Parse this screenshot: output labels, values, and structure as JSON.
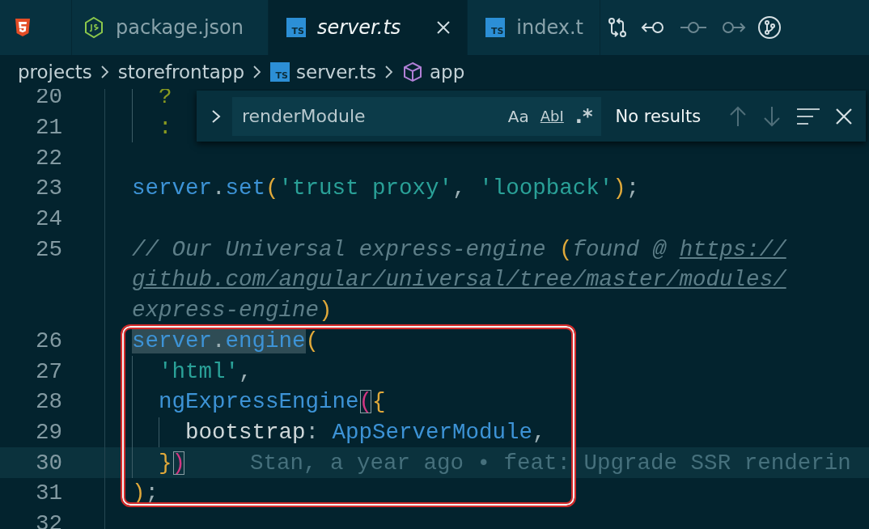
{
  "tabs": [
    {
      "kind": "html",
      "selected": false
    },
    {
      "kind": "node",
      "label": "package.json",
      "selected": false
    },
    {
      "kind": "ts",
      "badge": "TS",
      "label": "server.ts",
      "selected": true
    },
    {
      "kind": "ts",
      "badge": "TS",
      "label": "index.t",
      "selected": false
    }
  ],
  "breadcrumb": [
    {
      "kind": "folder",
      "label": "projects"
    },
    {
      "kind": "folder",
      "label": "storefrontapp"
    },
    {
      "kind": "ts",
      "badge": "TS",
      "label": "server.ts"
    },
    {
      "kind": "module",
      "label": "app"
    }
  ],
  "find": {
    "value": "renderModule",
    "options": [
      "Aa",
      "AbI",
      ".*"
    ],
    "status": "No results"
  },
  "lines": [
    {
      "number": "20",
      "current": false,
      "visual_lines": [
        {
          "tokens": [
            {
              "kind": "op",
              "t": "  ?"
            }
          ]
        }
      ]
    },
    {
      "number": "21",
      "current": false,
      "visual_lines": [
        {
          "tokens": [
            {
              "kind": "op",
              "t": "  :"
            }
          ]
        }
      ]
    },
    {
      "number": "22",
      "current": false
    },
    {
      "number": "23",
      "current": false,
      "visual_lines": [
        {
          "tokens": [
            {
              "kind": "var",
              "t": "server"
            },
            {
              "kind": "punct",
              "t": "."
            },
            {
              "kind": "var",
              "t": "set"
            },
            {
              "kind": "bracket",
              "t": "("
            },
            {
              "kind": "string",
              "t": "'trust proxy'"
            },
            {
              "kind": "punct",
              "t": ", "
            },
            {
              "kind": "string",
              "t": "'loopback'"
            },
            {
              "kind": "bracket",
              "t": ")"
            },
            {
              "kind": "punct",
              "t": ";"
            }
          ]
        }
      ]
    },
    {
      "number": "24",
      "current": false
    },
    {
      "number": "25",
      "current": false,
      "visual_lines": [
        {
          "tokens": [
            {
              "kind": "comment",
              "t": "// Our Universal express-engine "
            },
            {
              "kind": "bracket",
              "t": "("
            },
            {
              "kind": "comment",
              "t": "found @ "
            },
            {
              "kind": "link",
              "t": "https://"
            }
          ]
        },
        {
          "tokens": [
            {
              "kind": "link",
              "t": "github.com/angular/universal/tree/master/modules/"
            }
          ]
        },
        {
          "tokens": [
            {
              "kind": "comment",
              "t": "express-engine"
            },
            {
              "kind": "bracket",
              "t": ")"
            }
          ]
        }
      ]
    },
    {
      "number": "26",
      "current": false,
      "visual_lines": [
        {
          "tokens": [
            {
              "kind": "var-hl",
              "t": "server"
            },
            {
              "kind": "punct-hl",
              "t": "."
            },
            {
              "kind": "var-hl",
              "t": "engine"
            },
            {
              "kind": "bracket",
              "t": "("
            }
          ]
        }
      ]
    },
    {
      "number": "27",
      "current": false,
      "visual_lines": [
        {
          "tokens": [
            {
              "kind": "string",
              "t": "  'html'"
            },
            {
              "kind": "punct",
              "t": ","
            }
          ]
        }
      ]
    },
    {
      "number": "28",
      "current": false,
      "visual_lines": [
        {
          "tokens": [
            {
              "kind": "var",
              "t": "  ngExpressEngine"
            },
            {
              "kind": "bracket-match",
              "t": "("
            },
            {
              "kind": "bracket",
              "t": "{"
            }
          ]
        }
      ]
    },
    {
      "number": "29",
      "current": false,
      "visual_lines": [
        {
          "tokens": [
            {
              "kind": "prop",
              "t": "    bootstrap"
            },
            {
              "kind": "punct",
              "t": ": "
            },
            {
              "kind": "var",
              "t": "AppServerModule"
            },
            {
              "kind": "punct",
              "t": ","
            }
          ]
        }
      ]
    },
    {
      "number": "30",
      "current": true,
      "blame": "Stan, a year ago • feat: Upgrade SSR renderin",
      "visual_lines": [
        {
          "tokens": [
            {
              "kind": "bracket",
              "t": "  }"
            },
            {
              "kind": "bracket-match",
              "t": ")"
            }
          ]
        }
      ]
    },
    {
      "number": "31",
      "current": false,
      "visual_lines": [
        {
          "tokens": [
            {
              "kind": "bracket",
              "t": ")"
            },
            {
              "kind": "punct",
              "t": ";"
            }
          ]
        }
      ]
    },
    {
      "number": "32",
      "current": false
    }
  ]
}
